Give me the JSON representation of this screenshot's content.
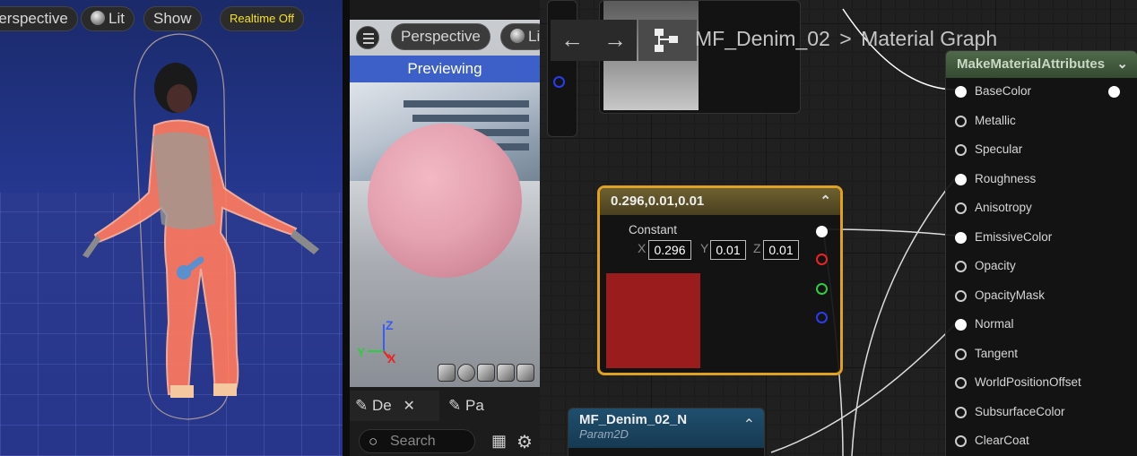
{
  "viewport": {
    "perspective_label": "Perspective",
    "lit_label": "Lit",
    "show_label": "Show",
    "realtime_label": "Realtime Off"
  },
  "preview": {
    "perspective_label": "Perspective",
    "lit_label": "Li",
    "previewing_label": "Previewing",
    "axis_z": "Z",
    "axis_y": "Y",
    "axis_x": "X"
  },
  "details": {
    "tab1_label": "De",
    "tab2_label": "Pa",
    "search_placeholder": "Search"
  },
  "graph": {
    "breadcrumb_asset": "MF_Denim_02",
    "breadcrumb_sep": ">",
    "breadcrumb_graph": "Material Graph"
  },
  "constant_node": {
    "title": "0.296,0.01,0.01",
    "label": "Constant",
    "x_label": "X",
    "x_value": "0.296",
    "y_label": "Y",
    "y_value": "0.01",
    "z_label": "Z",
    "z_value": "0.01",
    "swatch_color": "#9b1c1c"
  },
  "param_node": {
    "title": "MF_Denim_02_N",
    "subtitle": "Param2D"
  },
  "make_material_node": {
    "title": "MakeMaterialAttributes",
    "pins": [
      "BaseColor",
      "Metallic",
      "Specular",
      "Roughness",
      "Anisotropy",
      "EmissiveColor",
      "Opacity",
      "OpacityMask",
      "Normal",
      "Tangent",
      "WorldPositionOffset",
      "SubsurfaceColor",
      "ClearCoat"
    ]
  }
}
